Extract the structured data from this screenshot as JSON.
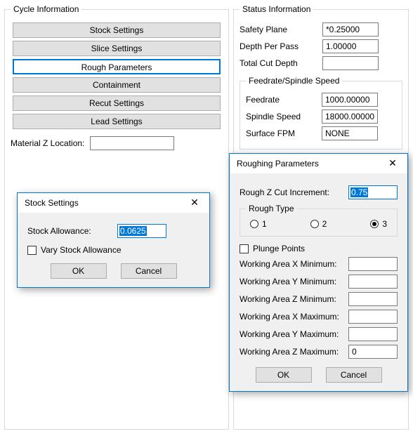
{
  "cycle": {
    "legend": "Cycle Information",
    "buttons": {
      "stock": "Stock Settings",
      "slice": "Slice Settings",
      "rough": "Rough Parameters",
      "contain": "Containment",
      "recut": "Recut Settings",
      "lead": "Lead Settings"
    },
    "materialZ": {
      "label": "Material Z Location:",
      "value": ""
    }
  },
  "status": {
    "legend": "Status Information",
    "safetyPlane": {
      "label": "Safety Plane",
      "value": "*0.25000"
    },
    "depthPerPass": {
      "label": "Depth Per Pass",
      "value": "1.00000"
    },
    "totalCutDepth": {
      "label": "Total Cut Depth",
      "value": ""
    },
    "feedSpindle": {
      "legend": "Feedrate/Spindle Speed",
      "feedrate": {
        "label": "Feedrate",
        "value": "1000.00000"
      },
      "spindle": {
        "label": "Spindle Speed",
        "value": "18000.00000"
      },
      "surfaceFPM": {
        "label": "Surface FPM",
        "value": "NONE"
      }
    }
  },
  "stockDlg": {
    "title": "Stock Settings",
    "allowance": {
      "label": "Stock Allowance:",
      "value": "0.0625"
    },
    "vary": {
      "label": "Vary Stock Allowance",
      "checked": false
    },
    "ok": "OK",
    "cancel": "Cancel"
  },
  "roughDlg": {
    "title": "Roughing Parameters",
    "zinc": {
      "label": "Rough Z Cut Increment:",
      "value": "0.75"
    },
    "roughType": {
      "legend": "Rough Type",
      "opt1": "1",
      "opt2": "2",
      "opt3": "3",
      "selected": 3
    },
    "plunge": {
      "label": "Plunge Points",
      "checked": false
    },
    "xmin": {
      "label": "Working Area X Minimum:",
      "value": ""
    },
    "ymin": {
      "label": "Working Area Y Minimum:",
      "value": ""
    },
    "zmin": {
      "label": "Working Area Z Minimum:",
      "value": ""
    },
    "xmax": {
      "label": "Working Area X Maximum:",
      "value": ""
    },
    "ymax": {
      "label": "Working Area Y Maximum:",
      "value": ""
    },
    "zmax": {
      "label": "Working Area Z Maximum:",
      "value": "0"
    },
    "ok": "OK",
    "cancel": "Cancel"
  }
}
